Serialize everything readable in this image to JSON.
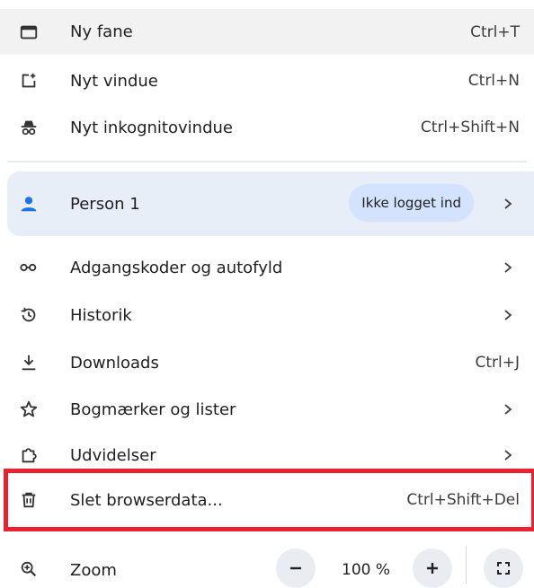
{
  "menu": {
    "items": [
      {
        "label": "Ny fane",
        "shortcut": "Ctrl+T",
        "icon": "new-tab-icon"
      },
      {
        "label": "Nyt vindue",
        "shortcut": "Ctrl+N",
        "icon": "new-window-icon"
      },
      {
        "label": "Nyt inkognitovindue",
        "shortcut": "Ctrl+Shift+N",
        "icon": "incognito-icon"
      }
    ],
    "profile": {
      "name": "Person 1",
      "status": "Ikke logget ind",
      "icon": "person-icon"
    },
    "items2": [
      {
        "label": "Adgangskoder og autofyld",
        "icon": "key-icon"
      },
      {
        "label": "Historik",
        "icon": "history-icon"
      },
      {
        "label": "Downloads",
        "shortcut": "Ctrl+J",
        "icon": "download-icon"
      },
      {
        "label": "Bogmærker og lister",
        "icon": "star-icon"
      },
      {
        "label": "Udvidelser",
        "icon": "extensions-icon"
      },
      {
        "label": "Slet browserdata...",
        "shortcut": "Ctrl+Shift+Del",
        "icon": "trash-icon"
      }
    ],
    "zoom": {
      "label": "Zoom",
      "value": "100 %",
      "minus": "−",
      "plus": "+",
      "icon": "zoom-icon",
      "fullscreen_icon": "fullscreen-icon"
    }
  },
  "colors": {
    "highlight_border": "#e8222e",
    "profile_bg": "#e8eef7",
    "pill_bg": "#d3e3fd"
  }
}
